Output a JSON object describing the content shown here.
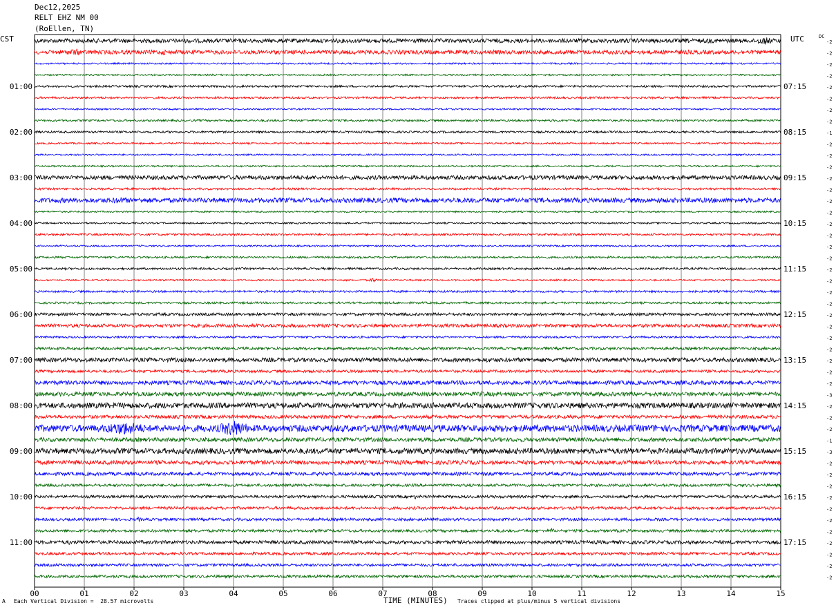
{
  "header": {
    "date": "Dec12,2025",
    "station": "RELT EHZ NM 00",
    "location": "(RoEllen, TN)"
  },
  "left_axis_title": "CST",
  "right_axis_title": "UTC",
  "dc_label": "DC",
  "footer": {
    "left_mark": "A",
    "scale_note": "Each Vertical Division =  28.57 microvolts",
    "x_title": "TIME (MINUTES)",
    "clip_note": "Traces clipped at plus/minus 5 vertical divisions"
  },
  "chart_data": {
    "type": "line",
    "title": "",
    "xlabel": "TIME (MINUTES)",
    "xlim": [
      0,
      15
    ],
    "x_ticks": [
      "00",
      "01",
      "02",
      "03",
      "04",
      "05",
      "06",
      "07",
      "08",
      "09",
      "10",
      "11",
      "12",
      "13",
      "14",
      "15"
    ],
    "trace_count": 48,
    "minutes_per_trace": 15,
    "trace_colors": [
      "#000000",
      "#ff0000",
      "#0000ff",
      "#006600"
    ],
    "left_hour_labels": [
      "01:00",
      "02:00",
      "03:00",
      "04:00",
      "05:00",
      "06:00",
      "07:00",
      "08:00",
      "09:00",
      "10:00",
      "11:00"
    ],
    "right_hour_labels": [
      "07:15",
      "08:15",
      "09:15",
      "10:15",
      "11:15",
      "12:15",
      "13:15",
      "14:15",
      "15:15",
      "16:15",
      "17:15"
    ],
    "dc_offsets": [
      "-2",
      "-2",
      "-2",
      "-2",
      "-2",
      "-2",
      "-2",
      "-2",
      "-1",
      "-2",
      "-2",
      "-2",
      "-2",
      "-2",
      "-2",
      "-2",
      "-2",
      "-2",
      "-2",
      "-2",
      "-2",
      "-2",
      "-2",
      "-2",
      "-2",
      "-2",
      "-2",
      "-2",
      "-2",
      "-2",
      "-2",
      "-3",
      "-2",
      "-2",
      "-2",
      "-1",
      "-3",
      "-2",
      "-2",
      "-2",
      "-2",
      "-2",
      "-2",
      "-2",
      "-2",
      "-2",
      "-2",
      "-2"
    ],
    "trace_amplitude": [
      3,
      3,
      1.2,
      1.2,
      1.5,
      1.5,
      1.2,
      1.5,
      1.5,
      1.2,
      1.2,
      1.2,
      3,
      1.5,
      3.5,
      1.2,
      1.2,
      1.5,
      1.2,
      1.5,
      1.5,
      1.2,
      1.5,
      1.5,
      2,
      2.5,
      1.5,
      2,
      3,
      2,
      3,
      3,
      4,
      2.5,
      5,
      3,
      4,
      3,
      2.5,
      2,
      2,
      2,
      2,
      2,
      2.5,
      2,
      2,
      2
    ],
    "events": [
      {
        "trace": 0,
        "from_minute": 10.0,
        "to_minute": 12.5,
        "level": 3
      },
      {
        "trace": 0,
        "from_minute": 13.2,
        "to_minute": 13.9,
        "level": 4
      },
      {
        "trace": 0,
        "from_minute": 14.3,
        "to_minute": 15.0,
        "level": 6
      },
      {
        "trace": 1,
        "from_minute": 0.4,
        "to_minute": 1.2,
        "level": 5
      },
      {
        "trace": 1,
        "from_minute": 2.3,
        "to_minute": 2.9,
        "level": 4
      },
      {
        "trace": 12,
        "from_minute": 8.5,
        "to_minute": 12.0,
        "level": 3
      },
      {
        "trace": 14,
        "from_minute": 1.2,
        "to_minute": 2.2,
        "level": 5
      },
      {
        "trace": 21,
        "from_minute": 6.7,
        "to_minute": 6.9,
        "level": 4
      },
      {
        "trace": 28,
        "from_minute": 8.9,
        "to_minute": 9.3,
        "level": 4
      },
      {
        "trace": 31,
        "from_minute": 8.7,
        "to_minute": 9.3,
        "level": 4
      },
      {
        "trace": 34,
        "from_minute": 1.0,
        "to_minute": 2.6,
        "level": 10
      },
      {
        "trace": 34,
        "from_minute": 3.5,
        "to_minute": 4.5,
        "level": 12
      },
      {
        "trace": 34,
        "from_minute": 13.7,
        "to_minute": 14.3,
        "level": 5
      },
      {
        "trace": 36,
        "from_minute": 5.9,
        "to_minute": 6.3,
        "level": 5
      },
      {
        "trace": 36,
        "from_minute": 11.2,
        "to_minute": 11.4,
        "level": 5
      },
      {
        "trace": 40,
        "from_minute": 7.6,
        "to_minute": 7.7,
        "level": 4
      },
      {
        "trace": 42,
        "from_minute": 2.05,
        "to_minute": 2.15,
        "level": 5
      },
      {
        "trace": 43,
        "from_minute": 10.3,
        "to_minute": 10.5,
        "level": 4
      },
      {
        "trace": 44,
        "from_minute": 0.6,
        "to_minute": 0.8,
        "level": 4
      }
    ]
  }
}
